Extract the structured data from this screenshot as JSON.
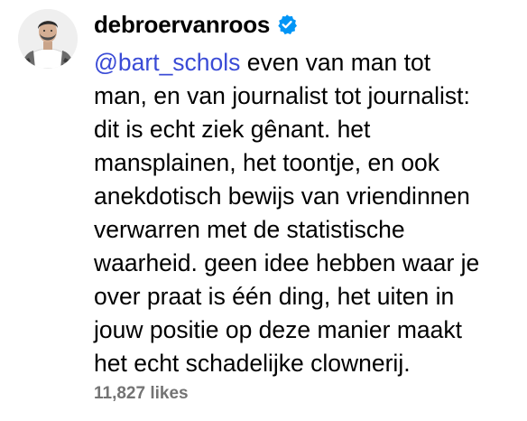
{
  "comment": {
    "username": "debroervanroos",
    "verified_icon": "verified-badge-icon",
    "verified_color": "#0095f6",
    "mention": "@bart_schols",
    "mention_color": "#3a4bd6",
    "body_lines": [
      " even van man tot",
      "man, en van journalist tot journalist:",
      "dit is echt ziek gênant. het",
      "mansplainen, het toontje, en ook",
      "anekdotisch bewijs van vriendinnen",
      "verwarren met de statistische",
      "waarheid. geen idee hebben waar je",
      "over praat is één ding, het uiten in",
      "jouw positie op deze manier maakt",
      "het echt schadelijke clownerij."
    ],
    "likes": "11,827 likes",
    "likes_color": "#737373",
    "avatar_icon": "profile-avatar"
  }
}
